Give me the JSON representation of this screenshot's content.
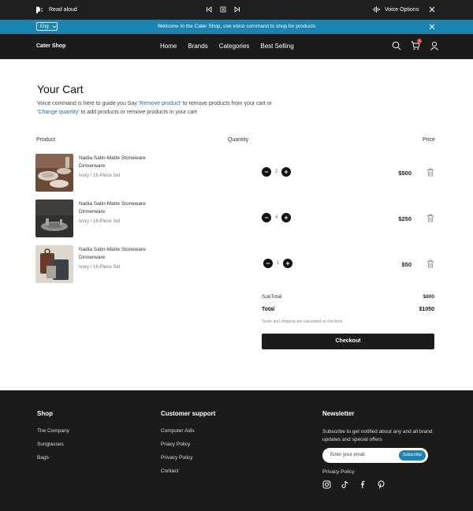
{
  "a11y_bar": {
    "read_aloud_label": "Read aloud",
    "voice_options_label": "Voice Options"
  },
  "announcement": {
    "language": "Eng",
    "text": "Welcome to the Cater Shop, use voice command to shop for products"
  },
  "nav": {
    "brand": "Cater Shop",
    "links": [
      "Home",
      "Brands",
      "Categories",
      "Best Selling"
    ],
    "cart_count": "1"
  },
  "cart": {
    "title": "Your Cart",
    "desc_prefix": "Voice command is here to guide you Say ",
    "cmd_remove": "'Remove product'",
    "desc_middle": " to remove products from your cart or ",
    "cmd_change": "'Change quantity'",
    "desc_suffix": " to add products  or remove products in your cart",
    "col_product": "Product",
    "col_quantity": "Quantity",
    "col_price": "Price",
    "items": [
      {
        "name": "Nadia Satin-Matte Stoneware Dinnerware",
        "variant": "Ivory / 16-Piece Set",
        "quantity": "2",
        "price": "$500"
      },
      {
        "name": "Nadia Satin-Matte Stoneware Dinnerware",
        "variant": "Ivory / 16-Piece Set",
        "quantity": "4",
        "price": "$250"
      },
      {
        "name": "Nadia Satin-Matte Stoneware Dinnerware",
        "variant": "Ivory / 16-Piece Set",
        "quantity": "1",
        "price": "$50"
      }
    ],
    "subtotal_label": "SubTotal",
    "subtotal_value": "$800",
    "total_label": "Total",
    "total_value": "$1050",
    "tax_note": "Taxes and shipping are calculated at checkout",
    "checkout_label": "Checkout"
  },
  "footer": {
    "shop_heading": "Shop",
    "shop_links": [
      "The Company",
      "Sunglasses",
      "Bags"
    ],
    "support_heading": "Customer support",
    "support_links": [
      "Computer Aids",
      "Priacy Policy",
      "Privacy Policy",
      "Contact"
    ],
    "newsletter_heading": "Newsletter",
    "newsletter_text": "Subscribe to get notified about any and all brand updates and special offers",
    "email_placeholder": "Enter your email",
    "subscribe_label": "Subscribe",
    "privacy_label": "Privacy Policy"
  },
  "colors": {
    "accent": "#1b84b0",
    "dark": "#1b1b1b",
    "badge": "#e04b3c"
  },
  "icons": [
    "speaker-icon",
    "skip-back-icon",
    "pause-icon",
    "skip-forward-icon",
    "voice-wave-icon",
    "close-icon",
    "chevron-down-icon",
    "search-icon",
    "cart-icon",
    "user-icon",
    "minus-icon",
    "plus-icon",
    "trash-icon",
    "instagram-icon",
    "tiktok-icon",
    "facebook-icon",
    "pinterest-icon"
  ]
}
